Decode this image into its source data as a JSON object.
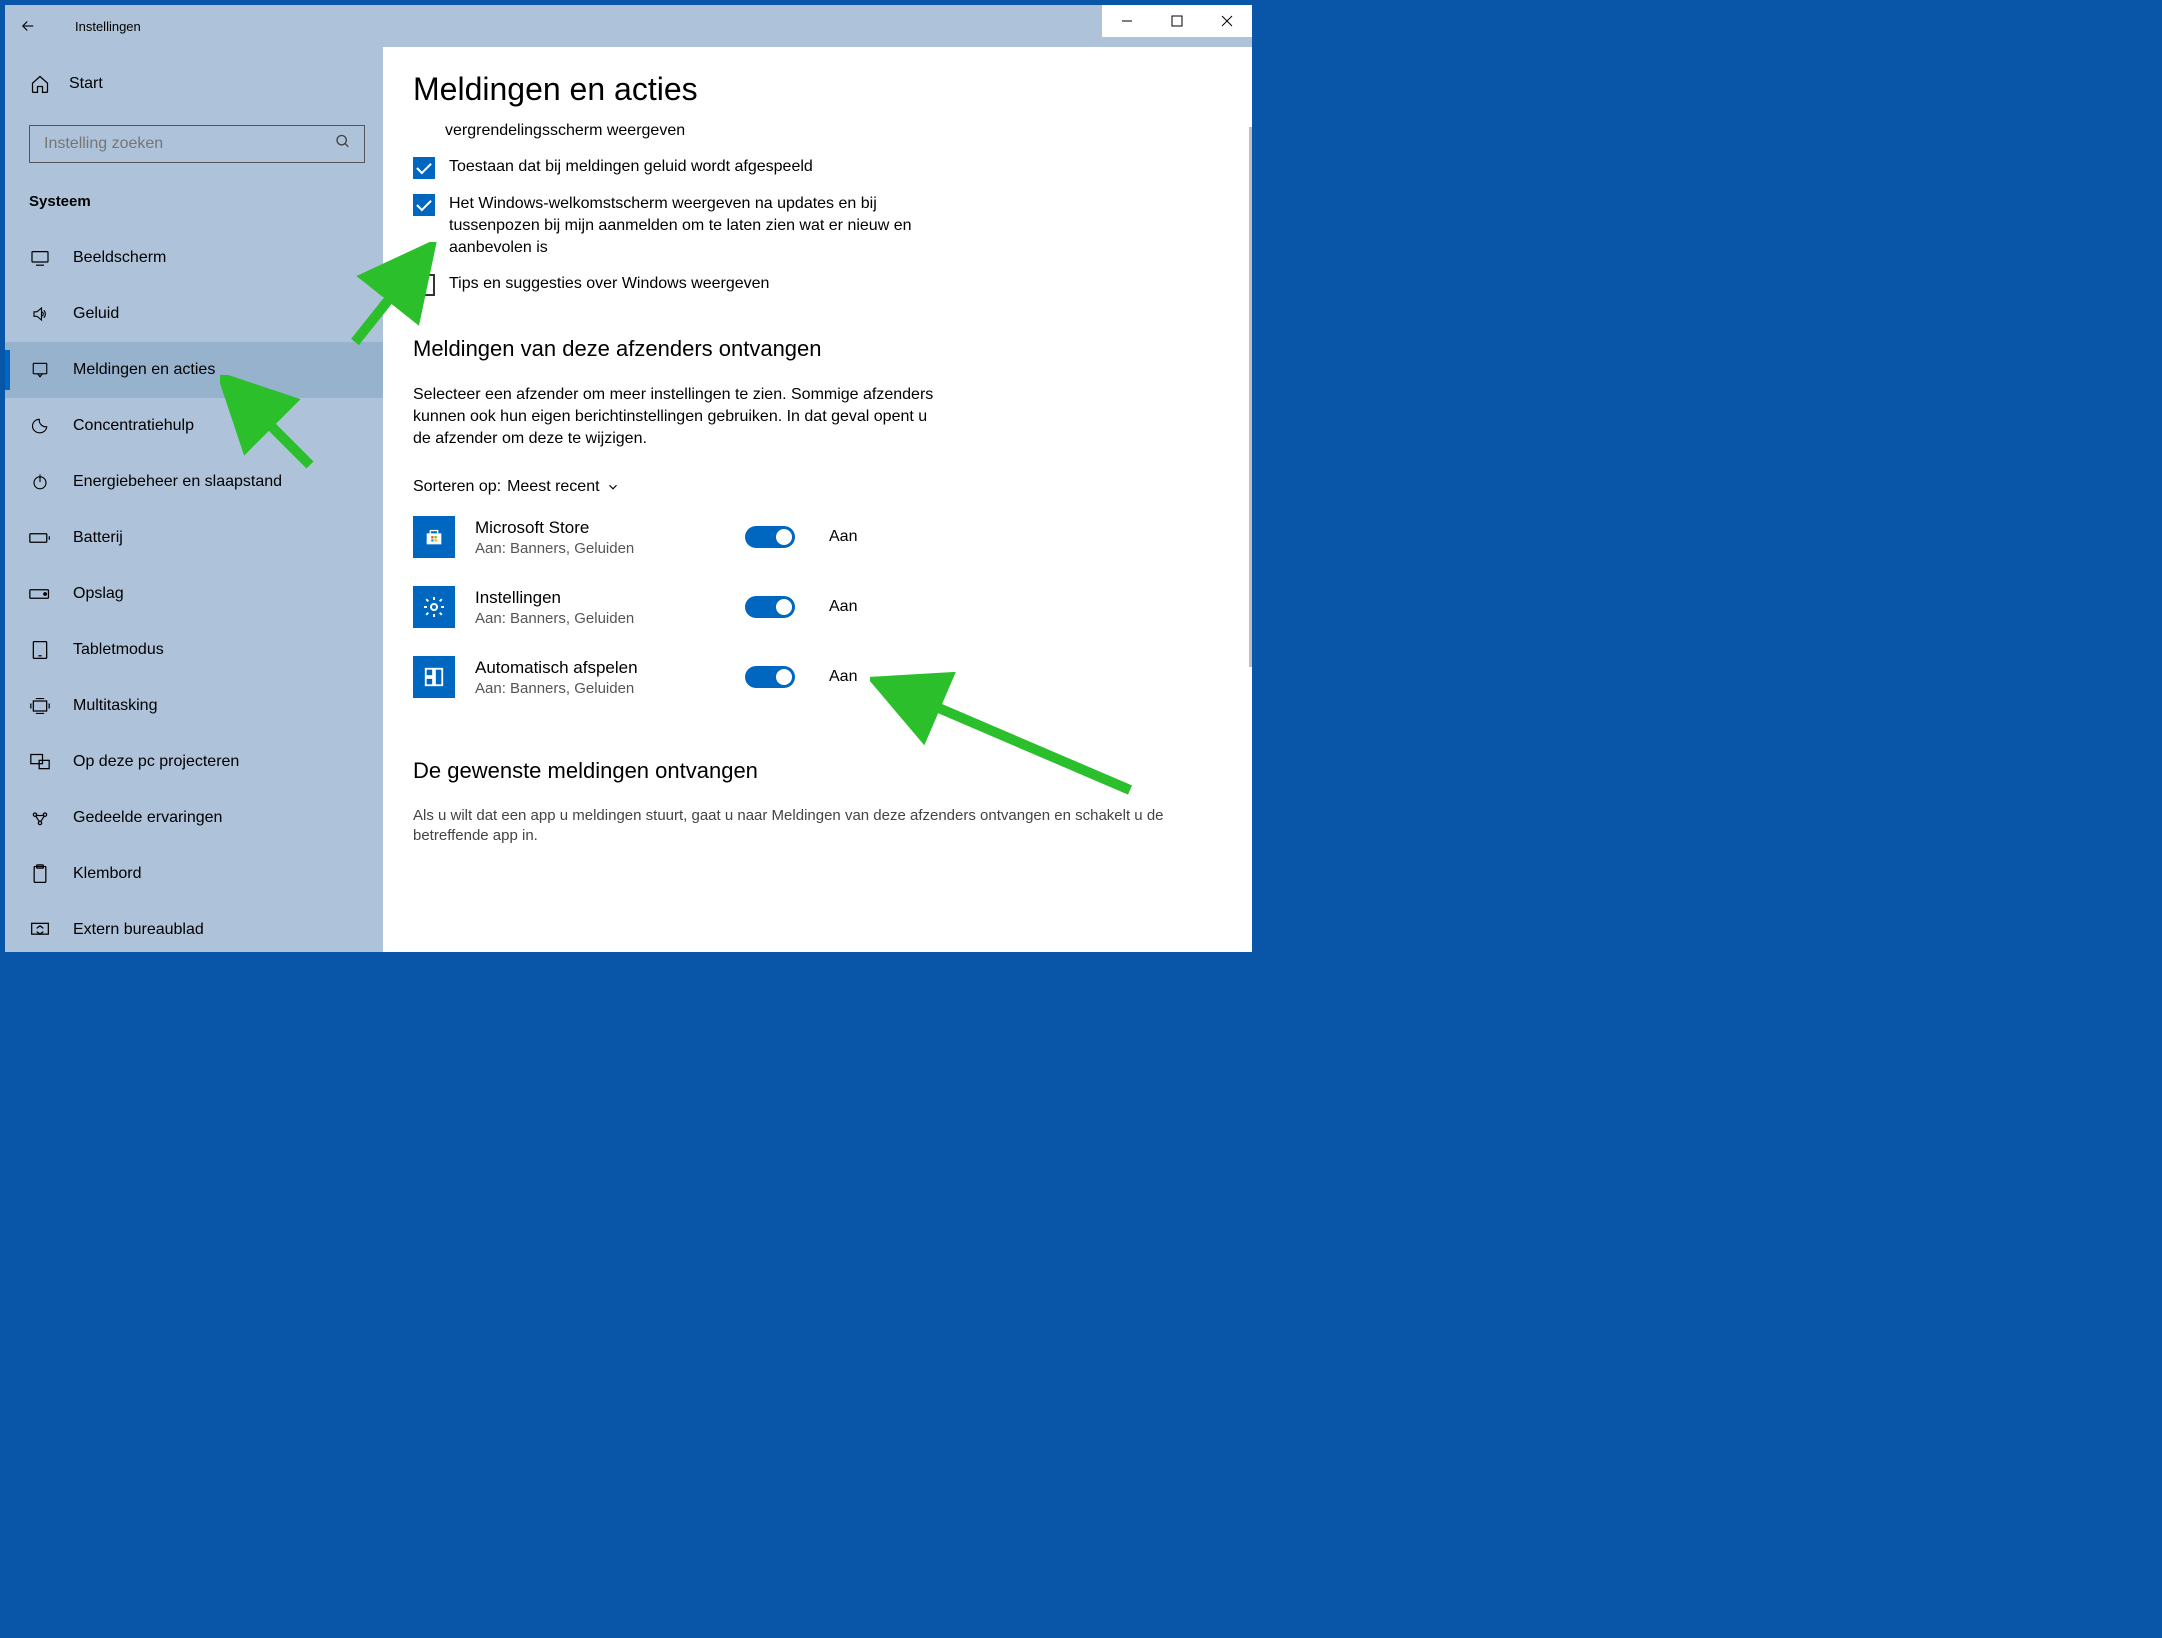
{
  "window": {
    "title": "Instellingen"
  },
  "sidebar": {
    "home": "Start",
    "search_placeholder": "Instelling zoeken",
    "category": "Systeem",
    "items": [
      {
        "label": "Beeldscherm"
      },
      {
        "label": "Geluid"
      },
      {
        "label": "Meldingen en acties"
      },
      {
        "label": "Concentratiehulp"
      },
      {
        "label": "Energiebeheer en slaapstand"
      },
      {
        "label": "Batterij"
      },
      {
        "label": "Opslag"
      },
      {
        "label": "Tabletmodus"
      },
      {
        "label": "Multitasking"
      },
      {
        "label": "Op deze pc projecteren"
      },
      {
        "label": "Gedeelde ervaringen"
      },
      {
        "label": "Klembord"
      },
      {
        "label": "Extern bureaublad"
      }
    ]
  },
  "main": {
    "title": "Meldingen en acties",
    "checkboxes": [
      {
        "label": "vergrendelingsscherm weergeven",
        "checked": true,
        "partial": true
      },
      {
        "label": "Toestaan dat bij meldingen geluid wordt afgespeeld",
        "checked": true
      },
      {
        "label": "Het Windows-welkomstscherm weergeven na updates en bij tussenpozen bij mijn aanmelden om te laten zien wat er nieuw en aanbevolen is",
        "checked": true
      },
      {
        "label": "Tips en suggesties over Windows weergeven",
        "checked": false
      }
    ],
    "subhead1": "Meldingen van deze afzenders ontvangen",
    "desc1": "Selecteer een afzender om meer instellingen te zien. Sommige afzenders kunnen ook hun eigen berichtinstellingen gebruiken. In dat geval opent u de afzender om deze te wijzigen.",
    "sort_label": "Sorteren op:",
    "sort_value": "Meest recent",
    "senders": [
      {
        "name": "Microsoft Store",
        "sub": "Aan: Banners, Geluiden",
        "state": "Aan",
        "icon": "store"
      },
      {
        "name": "Instellingen",
        "sub": "Aan: Banners, Geluiden",
        "state": "Aan",
        "icon": "gear"
      },
      {
        "name": "Automatisch afspelen",
        "sub": "Aan: Banners, Geluiden",
        "state": "Aan",
        "icon": "grid"
      }
    ],
    "subhead2": "De gewenste meldingen ontvangen",
    "desc2": "Als u wilt dat een app u meldingen stuurt, gaat u naar Meldingen van deze afzenders ontvangen en schakelt u de betreffende app in."
  }
}
